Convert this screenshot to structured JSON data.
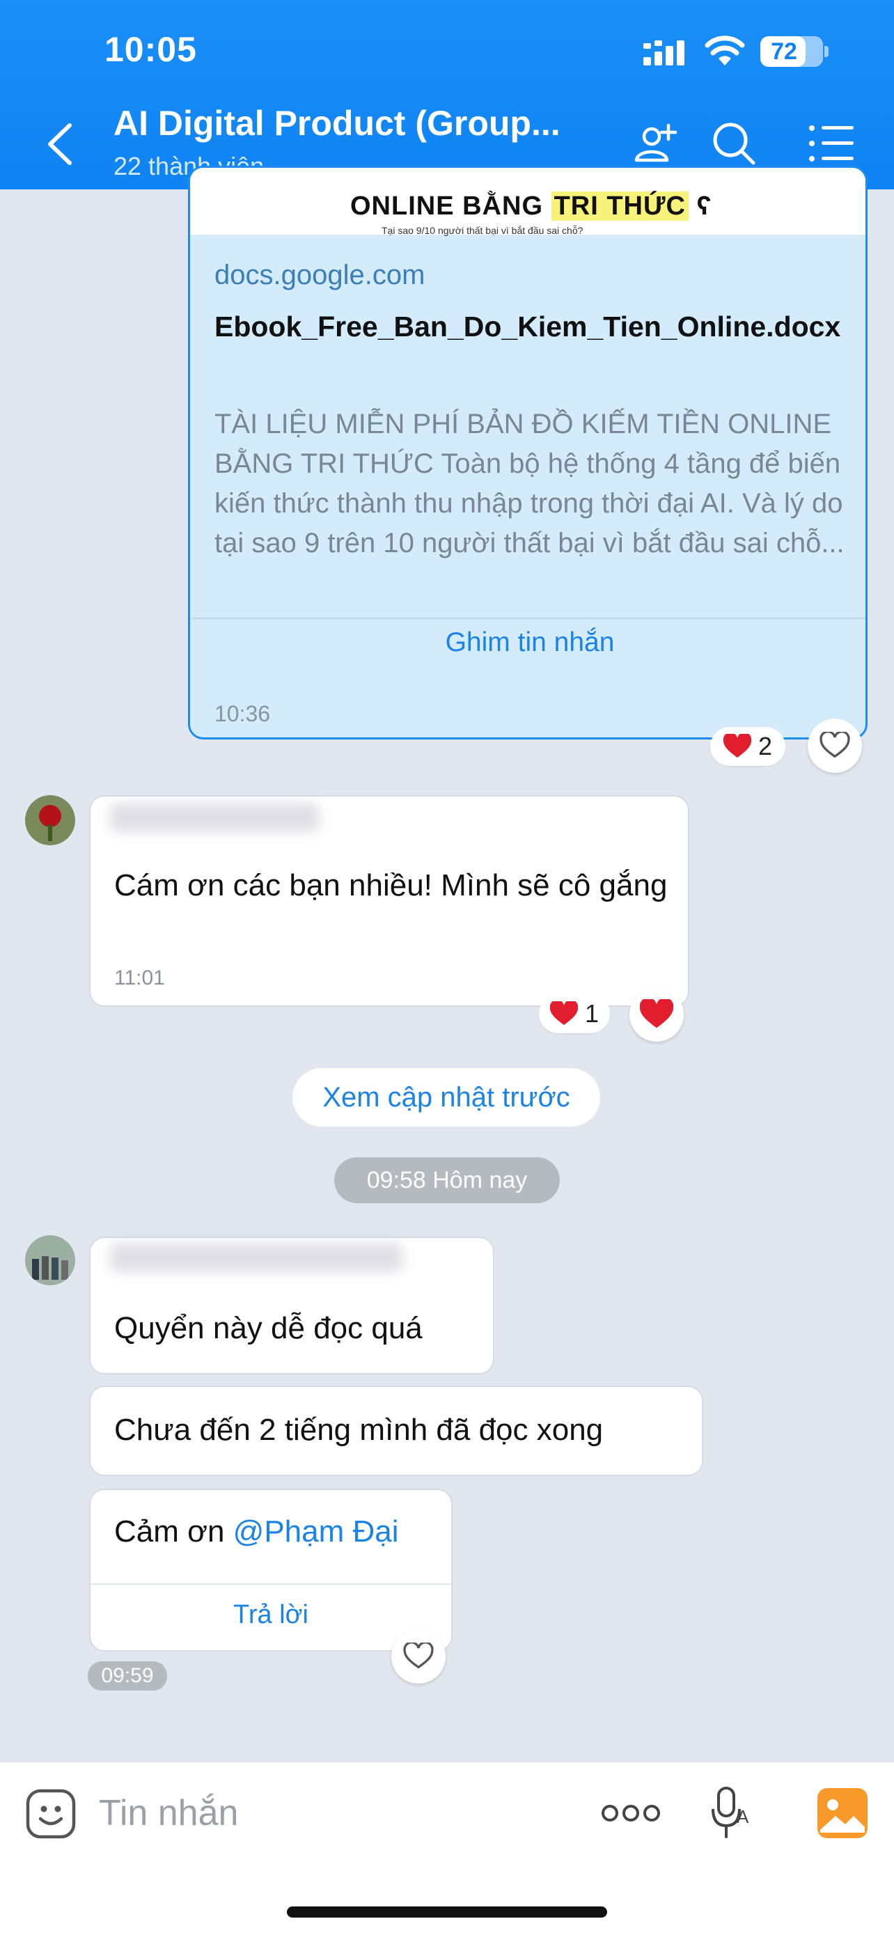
{
  "status_bar": {
    "time": "10:05",
    "battery": "72",
    "battery_level": 0.72
  },
  "header": {
    "title": "AI Digital Product (Group...",
    "subtitle": "22 thành viên",
    "icons": [
      "back-icon",
      "add-member-icon",
      "search-icon",
      "menu-list-icon"
    ]
  },
  "link_card": {
    "thumbnail_text": "ONLINE BẰNG",
    "thumbnail_highlight": "TRI THỨC",
    "thumbnail_sub": "Tại sao 9/10 người thất bại vì bắt đầu sai chỗ?",
    "domain": "docs.google.com",
    "title": "Ebook_Free_Ban_Do_Kiem_Tien_Online.docx",
    "description": "TÀI LIỆU MIỄN PHÍ BẢN ĐỒ KIẾM TIỀN ONLINE BẰNG TRI THỨC Toàn bộ hệ thống 4 tầng để biến kiến thức thành thu nhập trong thời đại AI. Và lý do tại sao 9 trên 10 người thất bại vì bắt đầu sai chỗ...",
    "pin_label": "Ghim tin nhắn",
    "time": "10:36",
    "reaction_count": "2"
  },
  "message1": {
    "text": "Cám ơn các bạn nhiều! Mình sẽ cô gắng",
    "time": "11:01",
    "reaction_count": "1"
  },
  "see_earlier": "Xem cập nhật trước",
  "date_divider": "09:58 Hôm nay",
  "message2": {
    "bubbles": [
      "Quyển này dễ đọc quá",
      "Chưa đến 2 tiếng mình đã đọc xong"
    ],
    "thanks_prefix": "Cảm ơn ",
    "mention": "@Phạm Đại",
    "reply_label": "Trả lời",
    "time": "09:59"
  },
  "input": {
    "placeholder": "Tin nhắn"
  },
  "colors": {
    "header": "#0f83f2",
    "accent": "#1a83e8",
    "chat_bg": "#e2e6ef",
    "card_bg": "#d3ebfb"
  }
}
